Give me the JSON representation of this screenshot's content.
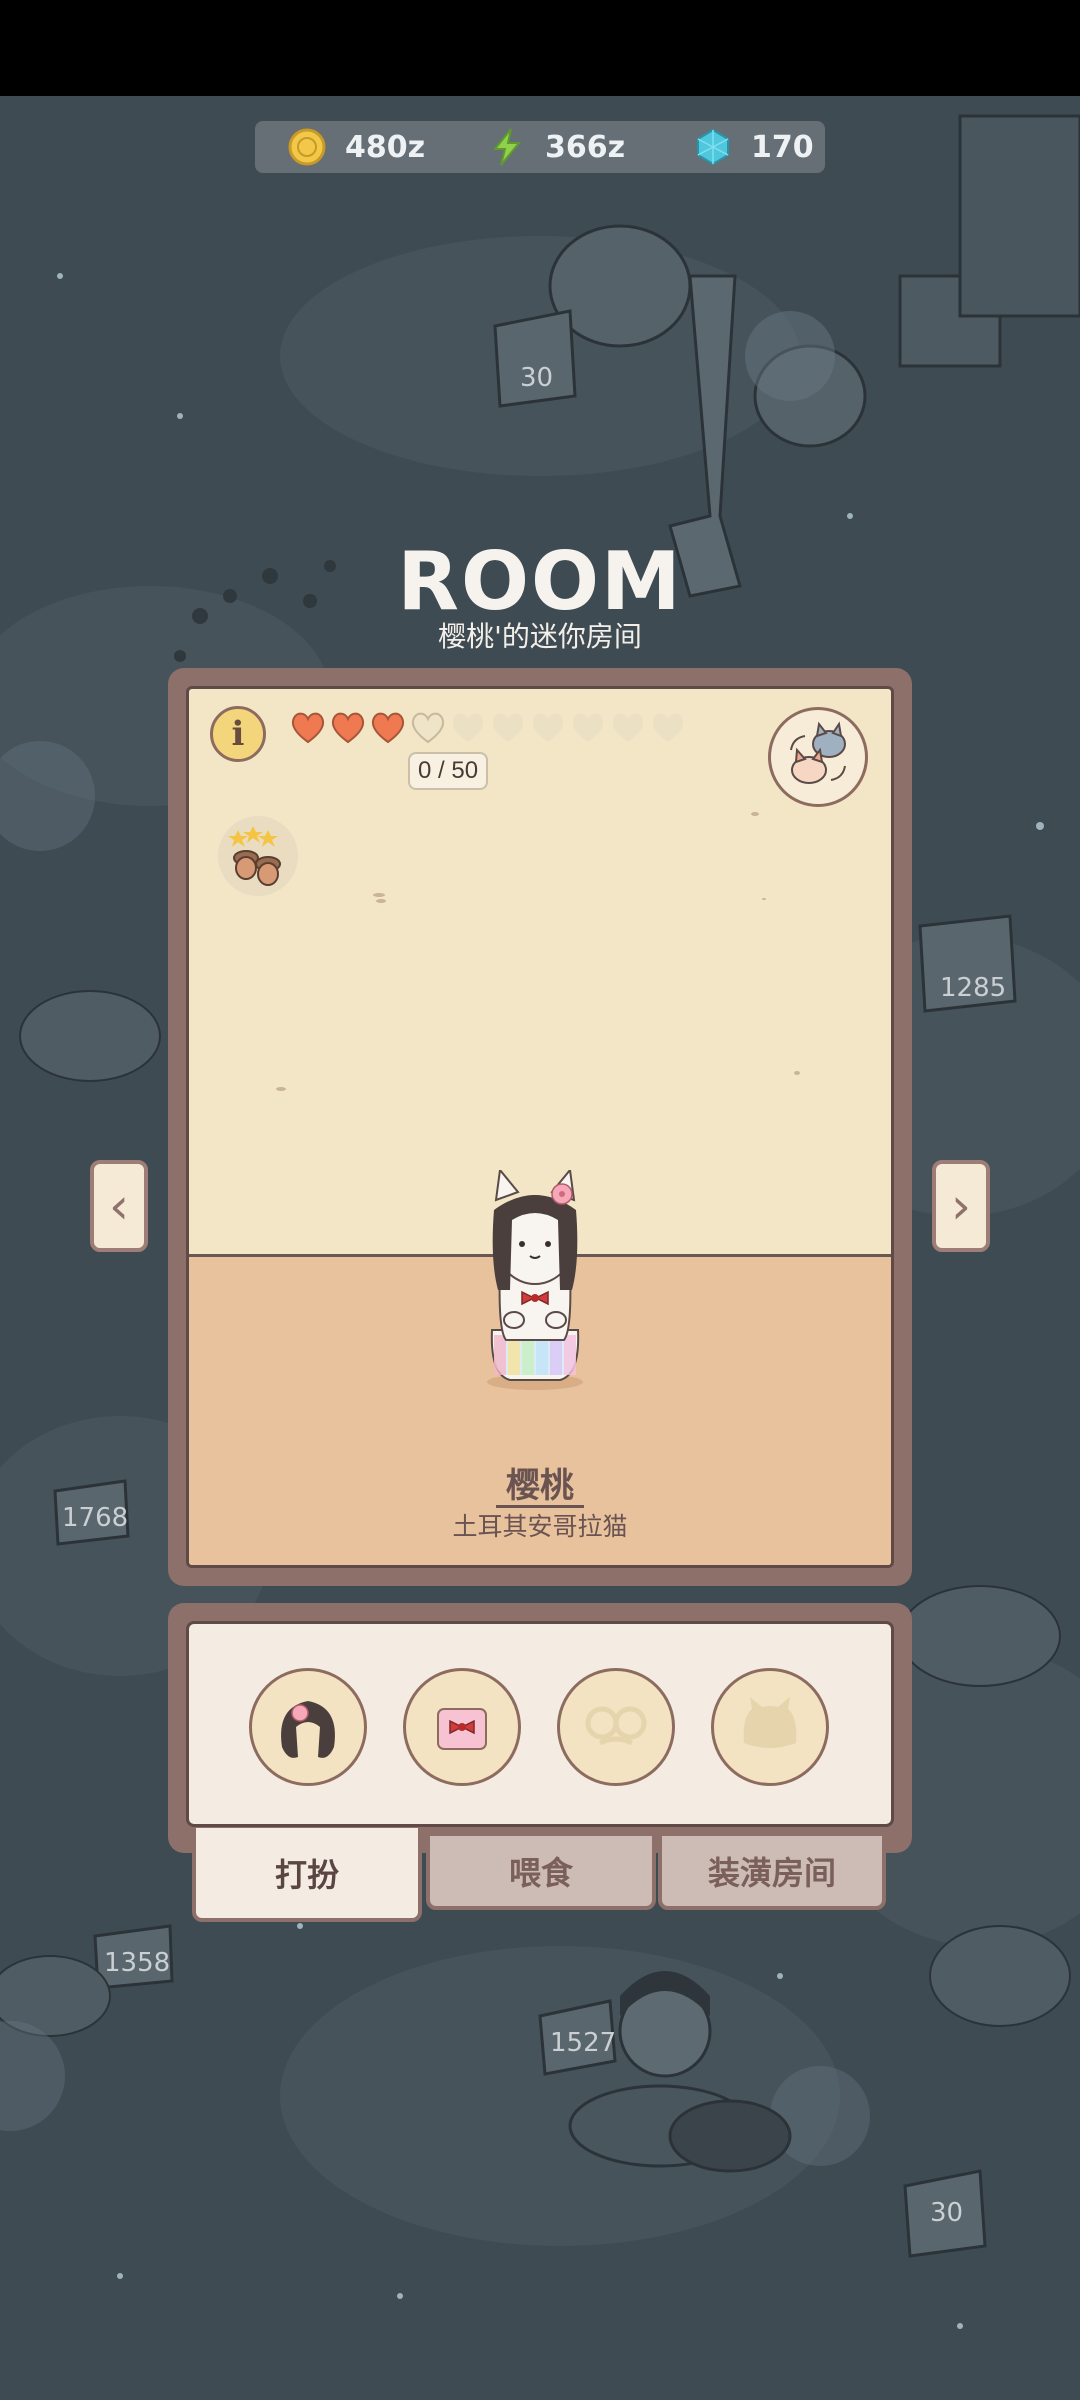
{
  "currency": {
    "coins": "480z",
    "energy": "366z",
    "gems": "170"
  },
  "header": {
    "title": "ROOM",
    "subtitle": "樱桃'的迷你房间"
  },
  "room": {
    "info_label": "i",
    "hearts_filled": 3,
    "hearts_total": 10,
    "affection_progress": "0 / 50",
    "pet_name": "樱桃",
    "pet_breed": "土耳其安哥拉猫"
  },
  "background": {
    "signs": [
      "30",
      "1285",
      "1768",
      "1358",
      "1527",
      "30"
    ]
  },
  "tabs": [
    {
      "label": "打扮"
    },
    {
      "label": "喂食"
    },
    {
      "label": "装潢房间"
    }
  ],
  "slots": [
    {
      "icon": "hair-icon"
    },
    {
      "icon": "outfit-icon"
    },
    {
      "icon": "glasses-icon"
    },
    {
      "icon": "face-icon"
    }
  ],
  "colors": {
    "panel_border": "#8d7069",
    "room_wall": "#f3e6c7",
    "room_floor": "#e8c29c",
    "heart_fill": "#ef7a52",
    "active_tab": "#f4ece3",
    "inactive_tab": "#cdbbb5"
  }
}
